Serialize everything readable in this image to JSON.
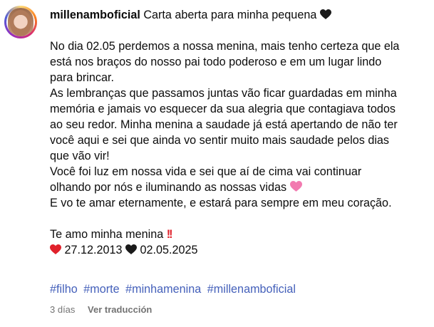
{
  "post": {
    "username": "millenamboficial",
    "title": "Carta aberta para minha pequena",
    "lines": [
      "No dia 02.05 perdemos a nossa menina, mais tenho certeza que ela",
      "está nos braços do nosso pai todo poderoso e em um lugar lindo",
      "para brincar.",
      "As lembranças que passamos juntas vão ficar guardadas em minha",
      "memória e jamais vo esquecer da sua alegria que contagiava todos",
      "ao seu redor. Minha menina a saudade já está apertando de não ter",
      "você aqui e sei que ainda vo sentir muito mais saudade pelos dias",
      "que vão vir!",
      "Você foi luz em nossa vida e sei que aí de cima vai continuar",
      "olhando por nós e iluminando as nossas vidas",
      "E vo te amar eternamente, e estará para sempre em meu coração."
    ],
    "closing": "Te amo minha menina",
    "birth_date": "27.12.2013",
    "death_date": "02.05.2025",
    "hashtags": [
      "#filho",
      "#morte",
      "#minhamenina",
      "#millenamboficial"
    ],
    "time_ago": "3 días",
    "translate_label": "Ver traducción"
  },
  "colors": {
    "hashtag": "#4460ba",
    "meta_text": "#737373",
    "heart_black": "#1a1a1a",
    "heart_red": "#e0212b",
    "heart_pink": "#f27ab0"
  },
  "icons": {
    "avatar": "profile-photo",
    "heart_black": "black-heart-emoji",
    "heart_red": "red-heart-emoji",
    "heart_pink": "pink-heart-emoji",
    "exclamation": "double-exclamation-emoji"
  }
}
